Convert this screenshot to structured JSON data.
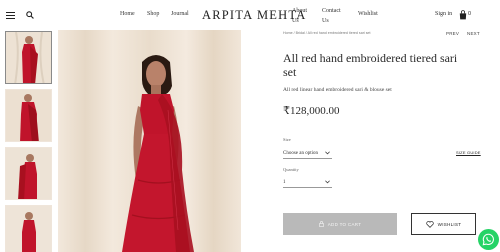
{
  "header": {
    "brand": "ARPITA MEHTA",
    "nav": {
      "home": "Home",
      "shop": "Shop",
      "journal": "Journal",
      "about_line1": "About",
      "about_line2": "Us",
      "contact_line1": "Contact",
      "contact_line2": "Us",
      "wishlist": "Wishlist"
    },
    "sign_in": "Sign in",
    "cart_count": "0"
  },
  "breadcrumb": "Home  /  Bridal  /  All red hand embroidered tiered sari set",
  "pager": {
    "prev": "PREV",
    "next": "NEXT"
  },
  "product": {
    "title": "All red hand embroidered tiered sari set",
    "subtitle": "All red linear hand embroidered sari & blouse set",
    "price": "₹128,000.00"
  },
  "size": {
    "label": "Size",
    "value": "Choose an option",
    "guide": "SIZE GUIDE"
  },
  "quantity": {
    "label": "Quantity",
    "value": "1"
  },
  "actions": {
    "add_to_cart": "ADD TO CART",
    "wishlist": "WISHLIST"
  },
  "colors": {
    "sari_red": "#c0142b",
    "backdrop": "#efe4d6",
    "button_gray": "#b9b9b9",
    "whatsapp": "#25d366"
  },
  "icons": [
    "menu-icon",
    "search-icon",
    "bag-icon",
    "chevron-down-icon",
    "lock-icon",
    "heart-icon",
    "whatsapp-icon"
  ]
}
